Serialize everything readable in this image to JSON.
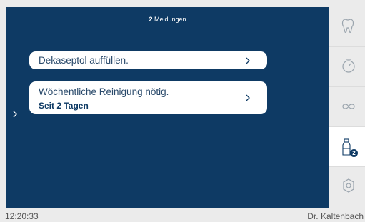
{
  "header": {
    "count": "2",
    "label": "Meldungen"
  },
  "messages": [
    {
      "title": "Dekaseptol auffüllen."
    },
    {
      "title": "Wöchentliche Reinigung nötig.",
      "subtitle": "Seit 2 Tagen"
    }
  ],
  "sidebar": {
    "items": [
      {
        "icon": "tooth-icon"
      },
      {
        "icon": "stopwatch-icon"
      },
      {
        "icon": "infinity-icon"
      },
      {
        "icon": "bottle-icon",
        "badge": "2",
        "active": true
      },
      {
        "icon": "gear-icon"
      }
    ]
  },
  "footer": {
    "time": "12:20:33",
    "brand": "Dr. Kaltenbach"
  },
  "colors": {
    "panel": "#0e3a64",
    "background": "#ebebeb",
    "card": "#ffffff",
    "icon": "#9aa4ad"
  }
}
